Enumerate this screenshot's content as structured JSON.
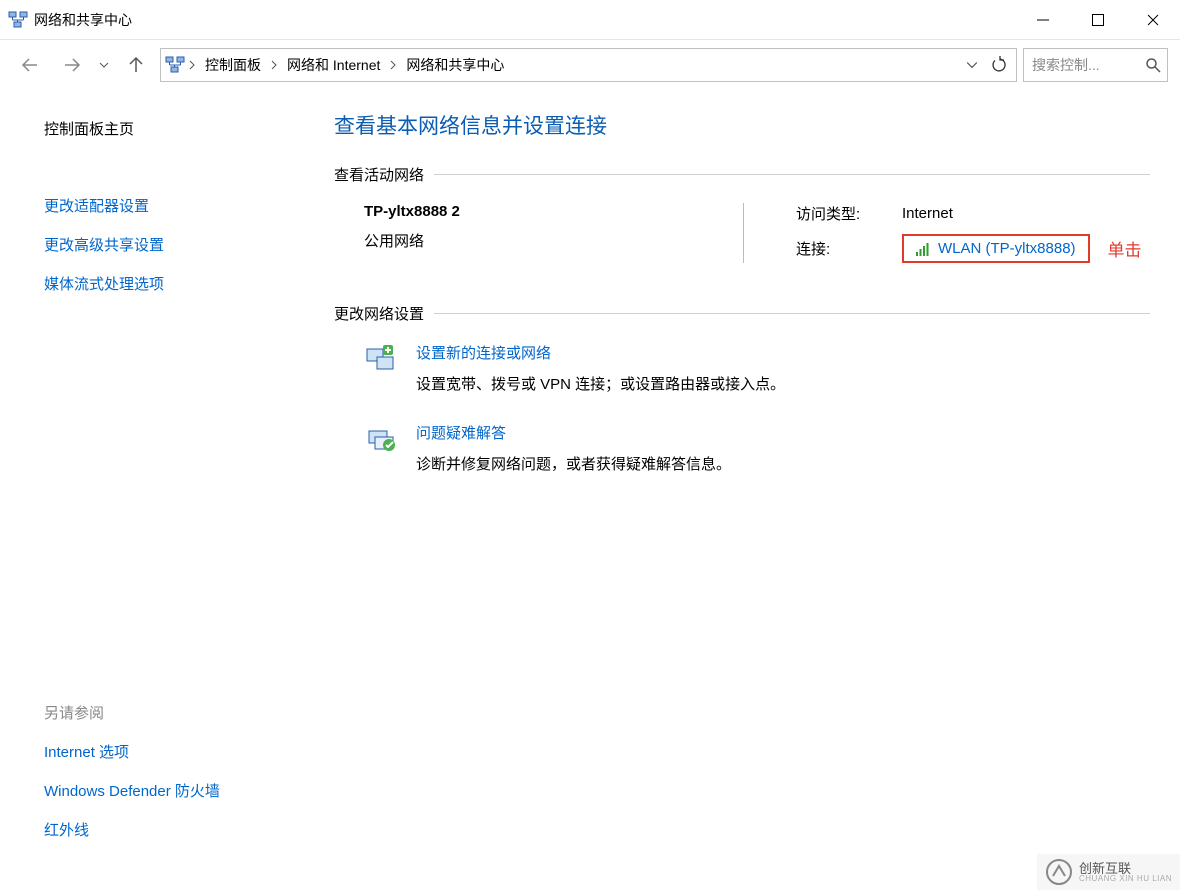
{
  "window": {
    "title": "网络和共享中心"
  },
  "breadcrumb": {
    "items": [
      "控制面板",
      "网络和 Internet",
      "网络和共享中心"
    ]
  },
  "search": {
    "placeholder": "搜索控制..."
  },
  "sidebar": {
    "home": "控制面板主页",
    "links": [
      "更改适配器设置",
      "更改高级共享设置",
      "媒体流式处理选项"
    ],
    "see_also_label": "另请参阅",
    "see_also": [
      "Internet 选项",
      "Windows Defender 防火墙",
      "红外线"
    ]
  },
  "main": {
    "heading": "查看基本网络信息并设置连接",
    "active_networks_label": "查看活动网络",
    "network": {
      "name": "TP-yltx8888 2",
      "type": "公用网络",
      "access_label": "访问类型:",
      "access_value": "Internet",
      "conn_label": "连接:",
      "conn_value": "WLAN (TP-yltx8888)"
    },
    "annotation": "单击",
    "change_settings_label": "更改网络设置",
    "settings": [
      {
        "link": "设置新的连接或网络",
        "desc": "设置宽带、拨号或 VPN 连接；或设置路由器或接入点。"
      },
      {
        "link": "问题疑难解答",
        "desc": "诊断并修复网络问题，或者获得疑难解答信息。"
      }
    ]
  },
  "watermark": {
    "text": "创新互联",
    "sub": "CHUANG XIN HU LIAN"
  }
}
